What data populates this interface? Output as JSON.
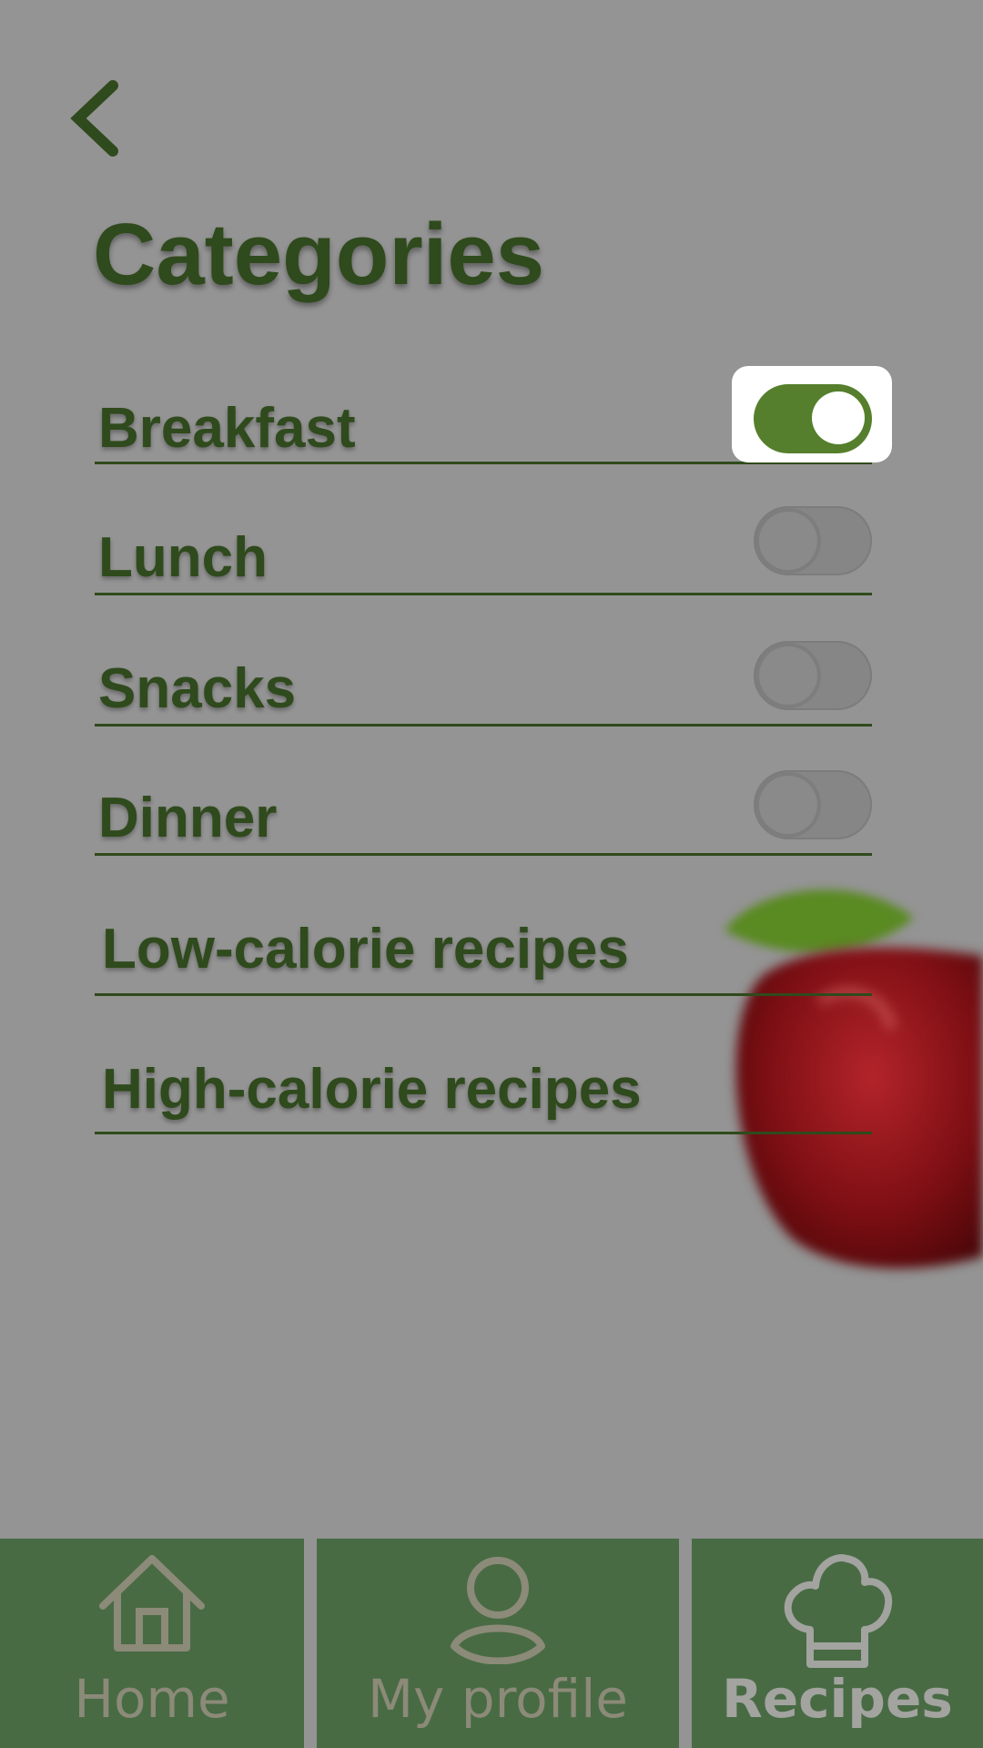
{
  "header": {
    "title": "Categories"
  },
  "categories": [
    {
      "label": "Breakfast",
      "toggle_on": true
    },
    {
      "label": "Lunch",
      "toggle_on": false
    },
    {
      "label": "Snacks",
      "toggle_on": false
    },
    {
      "label": "Dinner",
      "toggle_on": false
    },
    {
      "label": "Low-calorie recipes"
    },
    {
      "label": "High-calorie recipes"
    }
  ],
  "nav": {
    "tabs": [
      {
        "label": "Home",
        "icon": "house-icon"
      },
      {
        "label": "My profile",
        "icon": "person-icon"
      },
      {
        "label": "Recipes",
        "icon": "chef-hat-icon",
        "active": true
      }
    ]
  },
  "colors": {
    "background": "#949494",
    "accent": "#557f2c",
    "text": "#2f4a1c",
    "nav_background": "#486b44"
  }
}
